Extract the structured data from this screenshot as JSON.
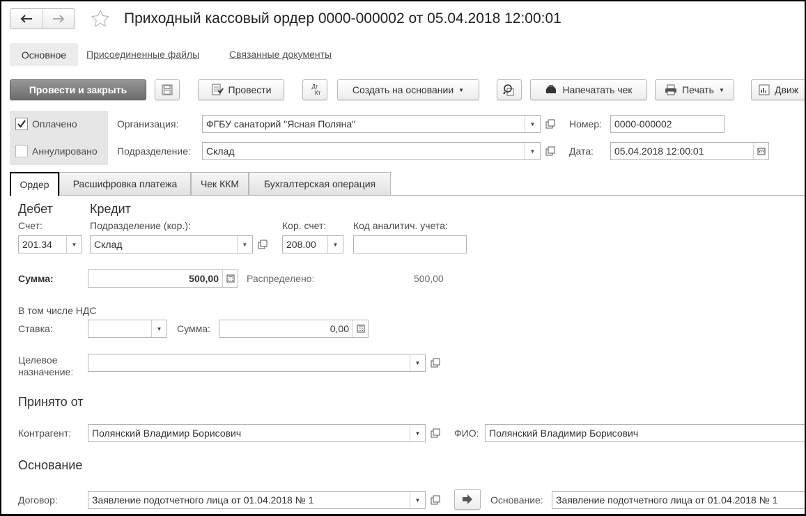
{
  "window": {
    "title": "Приходный кассовый ордер 0000-000002 от 05.04.2018 12:00:01"
  },
  "subnav": {
    "main": "Основное",
    "attached_files": "Присоединенные файлы",
    "related_docs": "Связанные документы"
  },
  "toolbar": {
    "post_and_close": "Провести и закрыть",
    "post": "Провести",
    "dtkt_top": "Дт",
    "dtkt_bottom": "Кт",
    "create_based_on": "Создать на основании",
    "print_receipt": "Напечатать чек",
    "print": "Печать",
    "movements": "Движ"
  },
  "header": {
    "paid_label": "Оплачено",
    "paid_checked": true,
    "cancelled_label": "Аннулировано",
    "cancelled_checked": false,
    "org_label": "Организация:",
    "org_value": "ФГБУ санаторий \"Ясная Поляна\"",
    "dept_label": "Подразделение:",
    "dept_value": "Склад",
    "number_label": "Номер:",
    "number_value": "0000-000002",
    "date_label": "Дата:",
    "date_value": "05.04.2018 12:00:01"
  },
  "tabs": [
    {
      "label": "Ордер",
      "active": true
    },
    {
      "label": "Расшифровка платежа",
      "active": false
    },
    {
      "label": "Чек ККМ",
      "active": false
    },
    {
      "label": "Бухгалтерская операция",
      "active": false
    }
  ],
  "order": {
    "debit_title": "Дебет",
    "credit_title": "Кредит",
    "account_label": "Счет:",
    "account_value": "201.34",
    "corr_dept_label": "Подразделение (кор.):",
    "corr_dept_value": "Склад",
    "corr_account_label": "Кор. счет:",
    "corr_account_value": "208.00",
    "analytic_code_label": "Код аналитич. учета:",
    "analytic_code_value": "",
    "sum_label": "Сумма:",
    "sum_value": "500,00",
    "distributed_label": "Распределено:",
    "distributed_value": "500,00",
    "vat_title": "В том числе НДС",
    "rate_label": "Ставка:",
    "rate_value": "",
    "vat_sum_label": "Сумма:",
    "vat_sum_value": "0,00",
    "purpose_label_1": "Целевое",
    "purpose_label_2": "назначение:",
    "purpose_value": "",
    "received_from_title": "Принято от",
    "counterparty_label": "Контрагент:",
    "counterparty_value": "Полянский Владимир Борисович",
    "fio_label": "ФИО:",
    "fio_value": "Полянский Владимир Борисович",
    "basis_title": "Основание",
    "contract_label": "Договор:",
    "contract_value": "Заявление подотчетного лица от 01.04.2018 № 1",
    "basis_label": "Основание:",
    "basis_value": "Заявление подотчетного лица от 01.04.2018 № 1"
  }
}
